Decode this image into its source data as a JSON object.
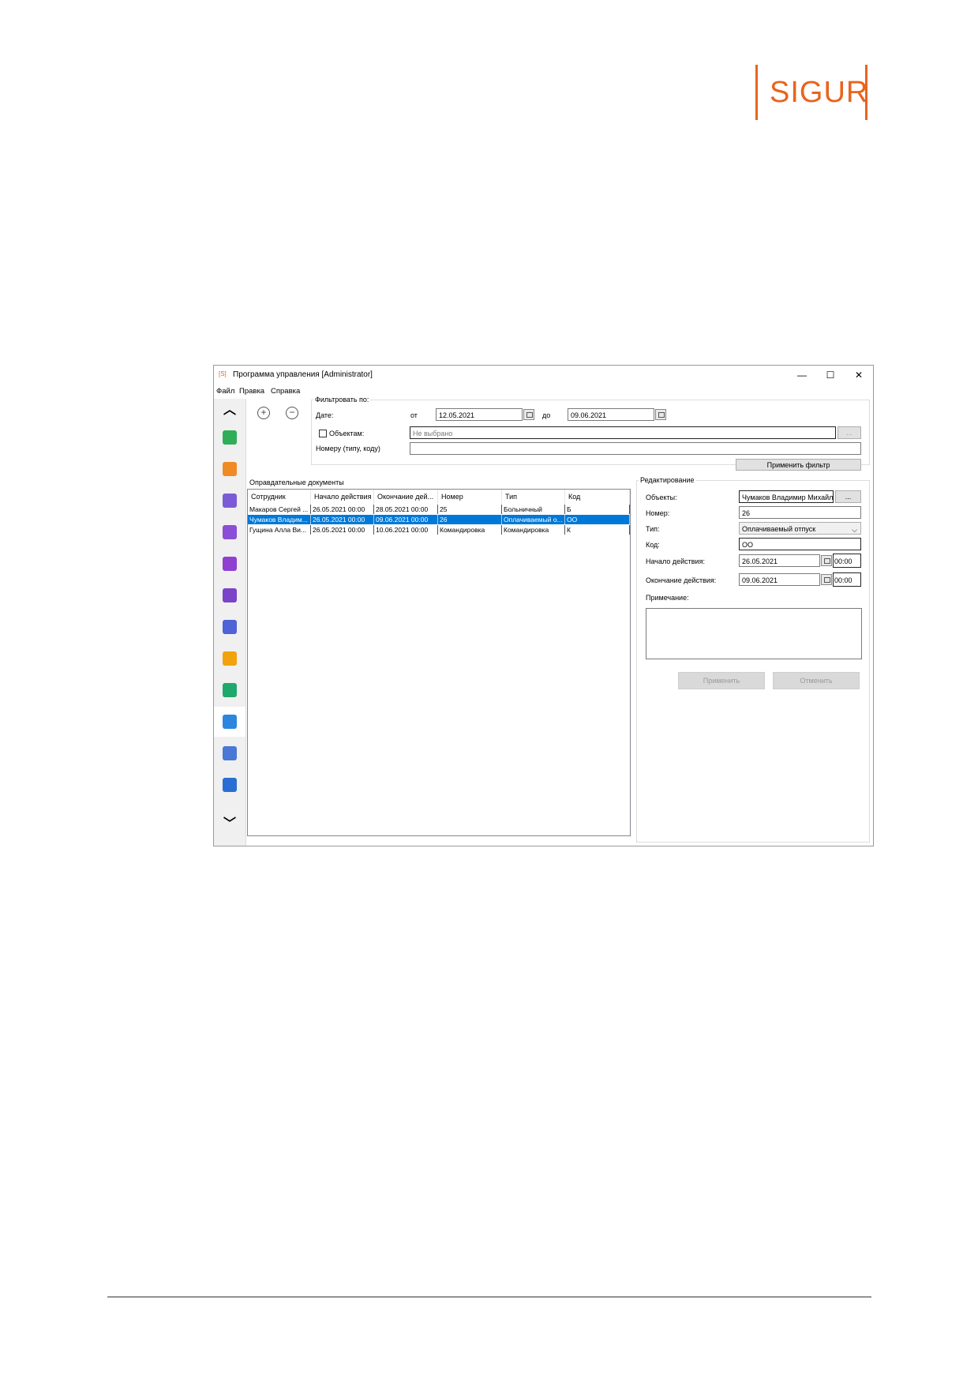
{
  "logo": {
    "text": "SIGUR"
  },
  "window": {
    "app_icon": "[S]",
    "title": "Программа управления [Administrator]",
    "controls": {
      "minimize": "—",
      "maximize": "☐",
      "close": "✕"
    }
  },
  "menu": [
    "Файл",
    "Правка",
    "Справка"
  ],
  "sidebar": {
    "up": "︿",
    "down": "﹀",
    "icons": [
      {
        "name": "monitor-icon",
        "color": "#2fae57"
      },
      {
        "name": "photo-frame-icon",
        "color": "#f08a24"
      },
      {
        "name": "id-card-icon",
        "color": "#7b5cd6"
      },
      {
        "name": "id-card-alert-icon",
        "color": "#8b4ed6"
      },
      {
        "name": "parking-settings-icon",
        "color": "#8f3fd1"
      },
      {
        "name": "parking-card-icon",
        "color": "#7a43c9"
      },
      {
        "name": "parking-list-icon",
        "color": "#4e63d6"
      },
      {
        "name": "users-icon",
        "color": "#f2a20c"
      },
      {
        "name": "clock-chart-icon",
        "color": "#1fa86b"
      },
      {
        "name": "documents-icon",
        "color": "#2d86de"
      },
      {
        "name": "car-alert-icon",
        "color": "#4a78d4"
      },
      {
        "name": "id-badge-icon",
        "color": "#2a6ed4"
      }
    ]
  },
  "toolbar": {
    "add": "+",
    "remove": "−"
  },
  "filter": {
    "legend": "Фильтровать по:",
    "date_label": "Дате:",
    "from_label": "от",
    "from_value": "12.05.2021",
    "to_label": "до",
    "to_value": "09.06.2021",
    "objects_label": "Объектам:",
    "objects_placeholder": "Не выбрано",
    "objects_btn": "...",
    "number_label": "Номеру (типу, коду)",
    "number_value": "",
    "apply_btn": "Применить фильтр"
  },
  "documents": {
    "legend": "Оправдательные документы",
    "columns": [
      "Сотрудник",
      "Начало действия",
      "Окончание дей...",
      "Номер",
      "Тип",
      "Код"
    ],
    "rows": [
      [
        "Макаров Сергей ...",
        "26.05.2021 00:00",
        "28.05.2021 00:00",
        "25",
        "Больничный",
        "Б"
      ],
      [
        "Чумаков Владим...",
        "26.05.2021 00:00",
        "09.06.2021 00:00",
        "26",
        "Оплачиваемый о...",
        "ОО"
      ],
      [
        "Гущина Алла Ви...",
        "26.05.2021 00:00",
        "10.06.2021 00:00",
        "Командировка",
        "Командировка",
        "К"
      ]
    ],
    "selected_row": 1
  },
  "edit": {
    "legend": "Редактирование",
    "objects_label": "Объекты:",
    "objects_value": "Чумаков Владимир Михайл...",
    "objects_btn": "...",
    "number_label": "Номер:",
    "number_value": "26",
    "type_label": "Тип:",
    "type_value": "Оплачиваемый отпуск",
    "code_label": "Код:",
    "code_value": "ОО",
    "start_label": "Начало действия:",
    "start_date": "26.05.2021",
    "start_time": "00:00",
    "end_label": "Окончание действия:",
    "end_date": "09.06.2021",
    "end_time": "00:00",
    "note_label": "Примечание:",
    "note_value": "",
    "apply_btn": "Применить",
    "cancel_btn": "Отменить"
  }
}
